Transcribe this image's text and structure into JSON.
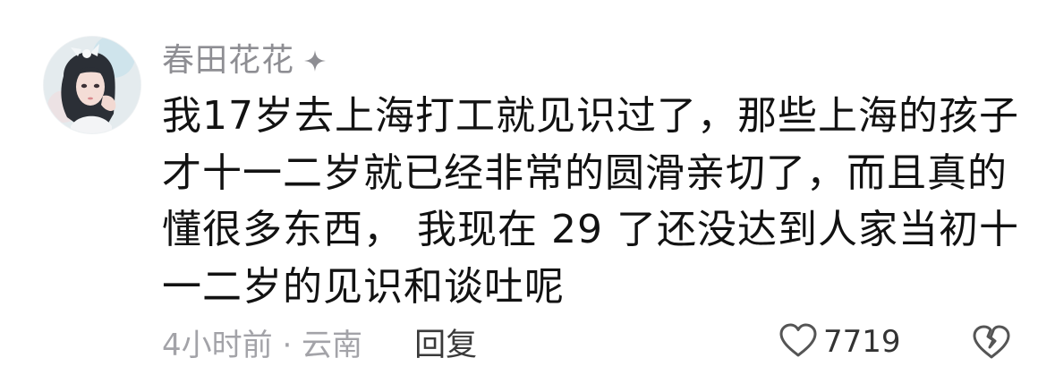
{
  "comment": {
    "username": "春田花花",
    "text": "我17岁去上海打工就见识过了，那些上海的孩子才十一二岁就已经非常的圆滑亲切了，而且真的懂很多东西， 我现在 29 了还没达到人家当初十一二岁的见识和谈吐呢",
    "time_location": "4小时前 · 云南",
    "reply_label": "回复",
    "like_count": "7719"
  },
  "icons": {
    "badge": "sparkle-icon",
    "like": "heart-outline-icon",
    "dislike": "broken-heart-icon"
  },
  "colors": {
    "username": "#8e8e93",
    "text": "#121212",
    "meta": "#a3a3a8",
    "reply": "#3a3a3a"
  }
}
